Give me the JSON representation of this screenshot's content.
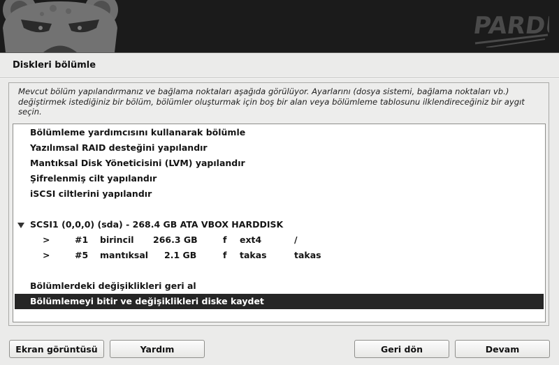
{
  "banner": {
    "logo_text": "PARDUS"
  },
  "page": {
    "title": "Diskleri bölümle",
    "description": "Mevcut bölüm yapılandırmanız ve bağlama noktaları aşağıda görülüyor. Ayarlarını (dosya sistemi, bağlama noktaları vb.) değiştirmek istediğiniz bir bölüm, bölümler oluşturmak için boş bir alan veya bölümleme tablosunu ilklendireceğiniz bir aygıt seçin."
  },
  "list": {
    "items": [
      {
        "label": "Bölümleme yardımcısını kullanarak bölümle"
      },
      {
        "label": "Yazılımsal RAID desteğini yapılandır"
      },
      {
        "label": "Mantıksal Disk Yöneticisini (LVM) yapılandır"
      },
      {
        "label": "Şifrelenmiş cilt yapılandır"
      },
      {
        "label": "iSCSI ciltlerini yapılandır"
      }
    ],
    "disk": {
      "label": "SCSI1 (0,0,0) (sda) - 268.4 GB ATA VBOX HARDDISK",
      "partitions": [
        {
          "arrow": ">",
          "num": "#1",
          "type": "birincil",
          "size": "266.3 GB",
          "flag": "f",
          "fs": "ext4",
          "mount": "/"
        },
        {
          "arrow": ">",
          "num": "#5",
          "type": "mantıksal",
          "size": "2.1 GB",
          "flag": "f",
          "fs": "takas",
          "mount": "takas"
        }
      ]
    },
    "undo_label": "Bölümlerdeki değişiklikleri geri al",
    "finish_label": "Bölümlemeyi bitir ve değişiklikleri diske kaydet"
  },
  "buttons": {
    "screenshot": "Ekran görüntüsü",
    "help": "Yardım",
    "back": "Geri dön",
    "continue": "Devam"
  }
}
